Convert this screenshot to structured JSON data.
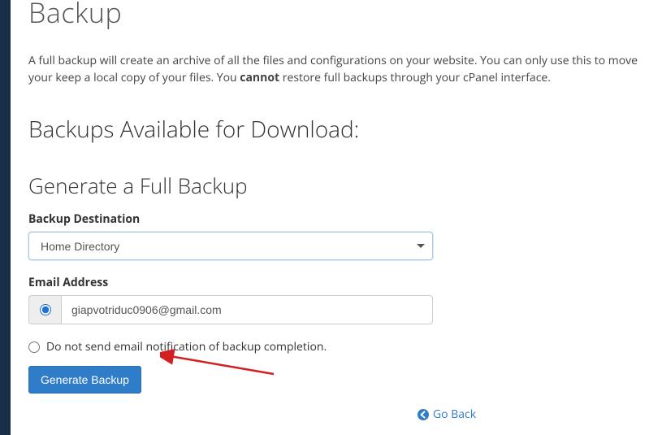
{
  "page": {
    "title": "Backup",
    "description_pre": "A full backup will create an archive of all the files and configurations on your website. You can only use this to move your keep a local copy of your files. You ",
    "description_bold": "cannot",
    "description_post": " restore full backups through your cPanel interface."
  },
  "section": {
    "available_heading": "Backups Available for Download:",
    "generate_heading": "Generate a Full Backup"
  },
  "form": {
    "destination_label": "Backup Destination",
    "destination_value": "Home Directory",
    "email_label": "Email Address",
    "email_value": "giapvotriduc0906@gmail.com",
    "no_email_label": "Do not send email notification of backup completion.",
    "submit_label": "Generate Backup"
  },
  "nav": {
    "go_back": "Go Back"
  },
  "colors": {
    "sidebar": "#1a2e4a",
    "primary": "#2f7cc8",
    "arrow": "#d22020"
  }
}
